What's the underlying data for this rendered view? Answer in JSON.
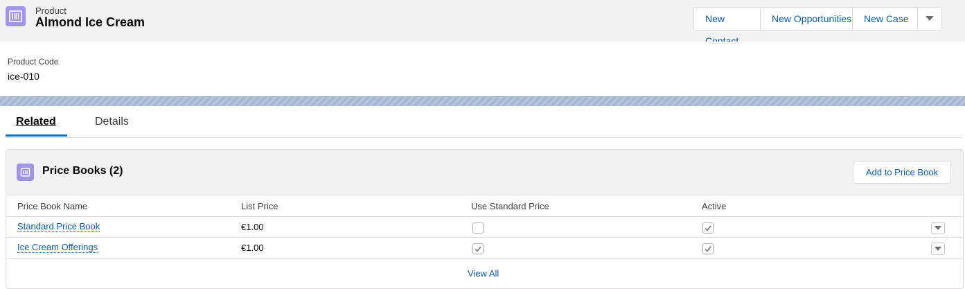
{
  "header": {
    "object_type": "Product",
    "title": "Almond Ice Cream",
    "icon": "product-icon",
    "actions": [
      {
        "label": "New Contact"
      },
      {
        "label": "New Opportunities"
      },
      {
        "label": "New Case"
      }
    ],
    "more_icon": "chevron-down-icon"
  },
  "highlights": {
    "product_code_label": "Product Code",
    "product_code_value": "ice-010"
  },
  "tabs": [
    {
      "label": "Related",
      "active": true
    },
    {
      "label": "Details",
      "active": false
    }
  ],
  "price_books": {
    "title": "Price Books (2)",
    "icon": "price-book-icon",
    "add_button": "Add to Price Book",
    "columns": [
      "Price Book Name",
      "List Price",
      "Use Standard Price",
      "Active"
    ],
    "rows": [
      {
        "name": "Standard Price Book",
        "list_price": "€1.00",
        "use_standard_price": false,
        "active": true
      },
      {
        "name": "Ice Cream Offerings",
        "list_price": "€1.00",
        "use_standard_price": true,
        "active": true
      }
    ],
    "view_all": "View All"
  },
  "colors": {
    "accent": "#0176d3",
    "link": "#0b5cab",
    "object_icon": "#a094ed",
    "band": "#a8b8d3"
  }
}
